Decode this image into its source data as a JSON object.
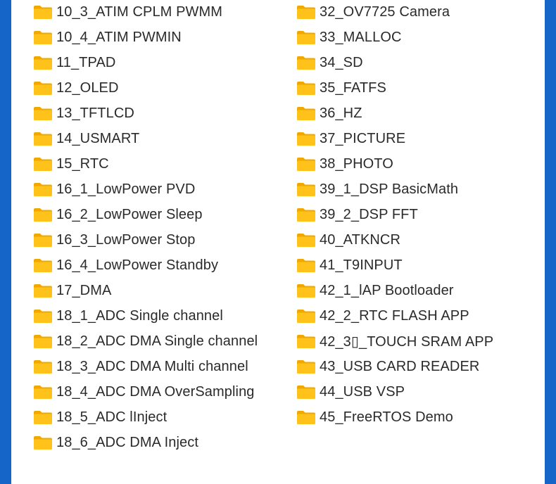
{
  "folders": {
    "left": [
      {
        "name": "10_3_ATIM CPLM PWMM",
        "icon": "folder-icon"
      },
      {
        "name": "10_4_ATIM PWMIN",
        "icon": "folder-icon"
      },
      {
        "name": "11_TPAD",
        "icon": "folder-icon"
      },
      {
        "name": "12_OLED",
        "icon": "folder-icon"
      },
      {
        "name": "13_TFTLCD",
        "icon": "folder-icon"
      },
      {
        "name": "14_USMART",
        "icon": "folder-icon"
      },
      {
        "name": "15_RTC",
        "icon": "folder-icon"
      },
      {
        "name": "16_1_LowPower PVD",
        "icon": "folder-icon"
      },
      {
        "name": "16_2_LowPower Sleep",
        "icon": "folder-icon"
      },
      {
        "name": "16_3_LowPower Stop",
        "icon": "folder-icon"
      },
      {
        "name": "16_4_LowPower Standby",
        "icon": "folder-icon"
      },
      {
        "name": "17_DMA",
        "icon": "folder-icon"
      },
      {
        "name": "18_1_ADC Single channel",
        "icon": "folder-icon"
      },
      {
        "name": "18_2_ADC DMA Single channel",
        "icon": "folder-icon"
      },
      {
        "name": "18_3_ADC DMA Multi channel",
        "icon": "folder-icon"
      },
      {
        "name": "18_4_ADC DMA OverSampling",
        "icon": "folder-icon"
      },
      {
        "name": "18_5_ADC lInject",
        "icon": "folder-icon"
      },
      {
        "name": "18_6_ADC DMA Inject",
        "icon": "folder-icon"
      }
    ],
    "right": [
      {
        "name": "32_OV7725 Camera",
        "icon": "folder-icon"
      },
      {
        "name": "33_MALLOC",
        "icon": "folder-icon"
      },
      {
        "name": "34_SD",
        "icon": "folder-icon"
      },
      {
        "name": "35_FATFS",
        "icon": "folder-icon"
      },
      {
        "name": "36_HZ",
        "icon": "folder-icon"
      },
      {
        "name": "37_PICTURE",
        "icon": "folder-icon"
      },
      {
        "name": "38_PHOTO",
        "icon": "folder-icon"
      },
      {
        "name": "39_1_DSP BasicMath",
        "icon": "folder-icon"
      },
      {
        "name": "39_2_DSP FFT",
        "icon": "folder-icon"
      },
      {
        "name": "40_ATKNCR",
        "icon": "folder-icon"
      },
      {
        "name": "41_T9INPUT",
        "icon": "folder-icon"
      },
      {
        "name": "42_1_lAP Bootloader",
        "icon": "folder-icon"
      },
      {
        "name": "42_2_RTC FLASH APP",
        "icon": "folder-icon"
      },
      {
        "name": "42_3▯_TOUCH SRAM APP",
        "icon": "folder-icon"
      },
      {
        "name": "43_USB CARD READER",
        "icon": "folder-icon"
      },
      {
        "name": "44_USB VSP",
        "icon": "folder-icon"
      },
      {
        "name": "45_FreeRTOS Demo",
        "icon": "folder-icon"
      }
    ]
  },
  "colors": {
    "frame": "#1565c8",
    "panel": "#ffffff",
    "folder": "#ffc21a",
    "folder_tab": "#f0a800",
    "text": "#2a2a2a"
  }
}
